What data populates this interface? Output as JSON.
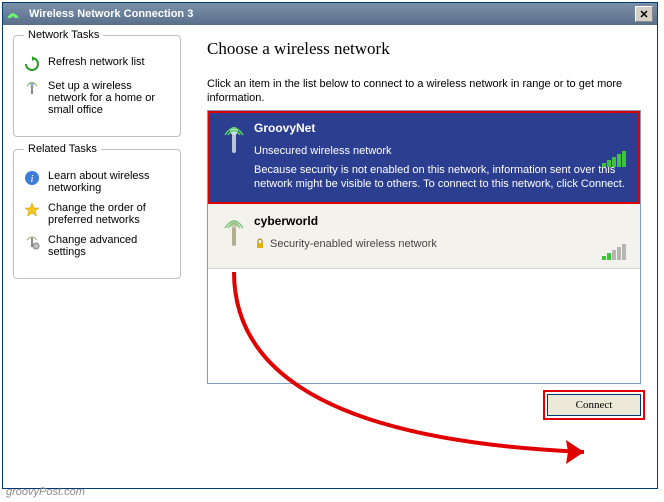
{
  "titlebar": {
    "title": "Wireless Network Connection 3"
  },
  "sidebar": {
    "group1": {
      "legend": "Network Tasks",
      "items": [
        {
          "label": "Refresh network list"
        },
        {
          "label": "Set up a wireless network for a home or small office"
        }
      ]
    },
    "group2": {
      "legend": "Related Tasks",
      "items": [
        {
          "label": "Learn about wireless networking"
        },
        {
          "label": "Change the order of preferred networks"
        },
        {
          "label": "Change advanced settings"
        }
      ]
    }
  },
  "main": {
    "heading": "Choose a wireless network",
    "instruction": "Click an item in the list below to connect to a wireless network in range or to get more information."
  },
  "networks": [
    {
      "name": "GroovyNet",
      "type": "Unsecured wireless network",
      "desc": "Because security is not enabled on this network, information sent over this network might be visible to others. To connect to this network, click Connect."
    },
    {
      "name": "cyberworld",
      "type": "Security-enabled wireless network",
      "desc": ""
    }
  ],
  "buttons": {
    "connect": "Connect"
  },
  "watermark": "groovyPost.com"
}
